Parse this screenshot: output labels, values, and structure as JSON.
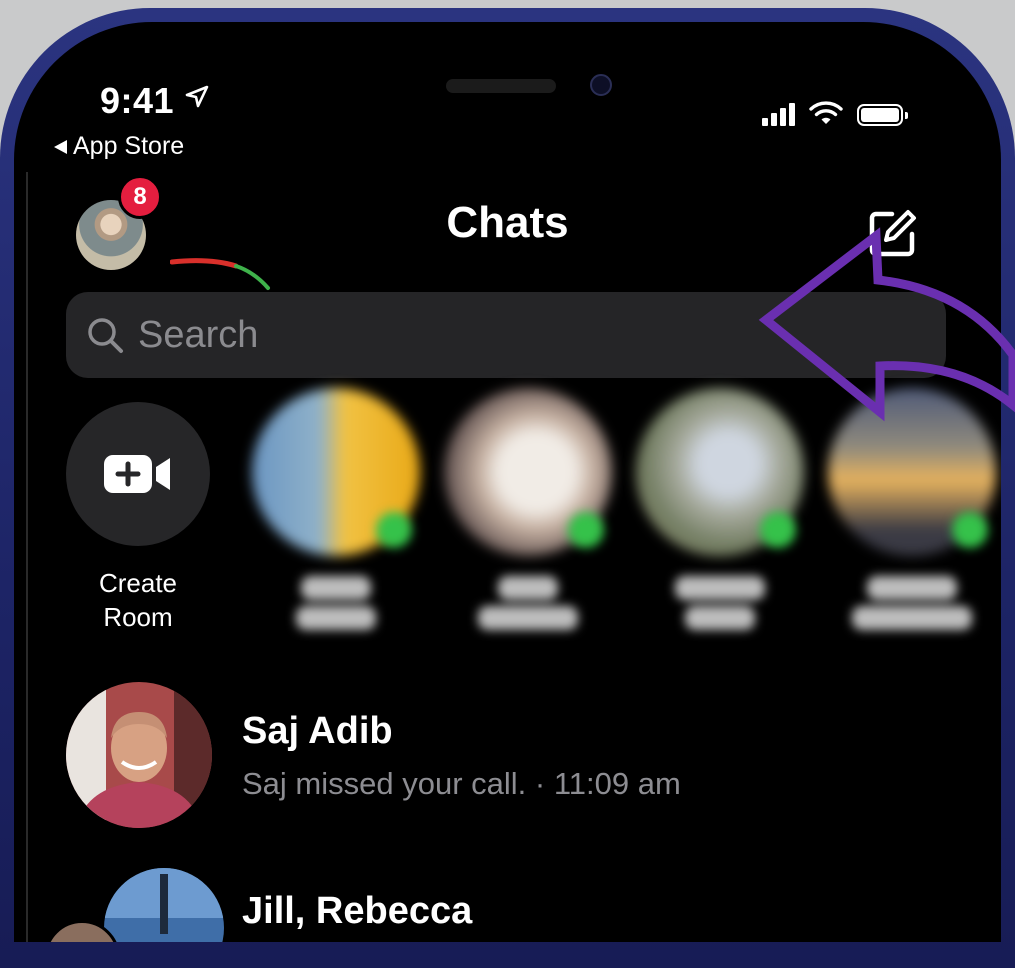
{
  "status_bar": {
    "time": "9:41",
    "back_app": "App Store",
    "icons": [
      "location-arrow-icon",
      "signal-icon",
      "wifi-icon",
      "battery-icon"
    ]
  },
  "header": {
    "title": "Chats",
    "notification_count": "8",
    "compose_icon": "compose-icon"
  },
  "search": {
    "placeholder": "Search"
  },
  "stories": {
    "create_room_line1": "Create",
    "create_room_line2": "Room"
  },
  "chats": [
    {
      "name": "Saj Adib",
      "preview": "Saj missed your call. · 11:09 am"
    },
    {
      "name": "Jill, Rebecca",
      "preview": ""
    }
  ],
  "colors": {
    "background": "#000000",
    "search_bg": "#252527",
    "badge": "#e41e3f",
    "online": "#35c24a",
    "annotation_arrow": "#6a2fb0",
    "frame": "#1f2670"
  }
}
